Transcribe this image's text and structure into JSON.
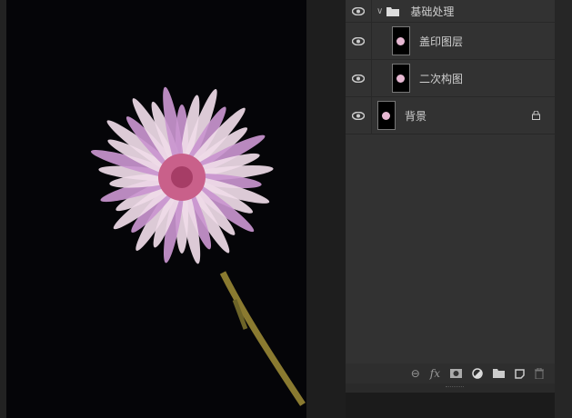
{
  "layers": [
    {
      "name": "基础处理",
      "type": "group",
      "expanded": true
    },
    {
      "name": "盖印图层",
      "type": "layer",
      "indented": true
    },
    {
      "name": "二次构图",
      "type": "layer",
      "indented": true
    },
    {
      "name": "背景",
      "type": "layer",
      "locked": true
    }
  ],
  "toolbar": [
    "link-icon",
    "fx-icon",
    "mask-icon",
    "adjustment-icon",
    "folder-icon",
    "new-layer-icon",
    "trash-icon"
  ],
  "toolbar_labels": {
    "fx": "fx"
  },
  "colors": {
    "panel": "#323232",
    "canvas": "#050508"
  }
}
